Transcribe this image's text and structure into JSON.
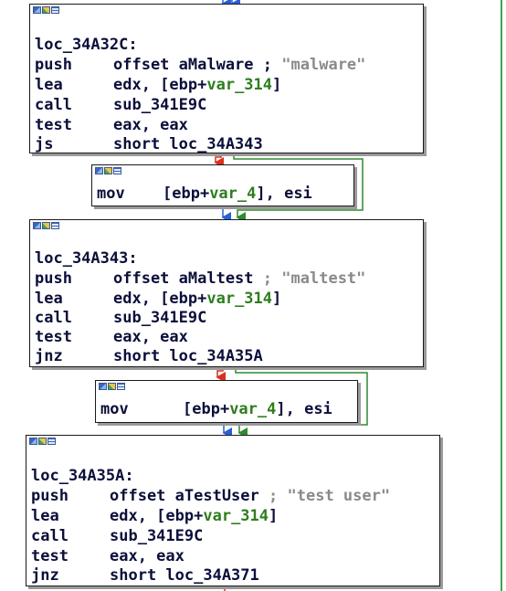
{
  "colors": {
    "true_edge": "#2e8b2e",
    "false_edge": "#d9301f",
    "flow_edge": "#2a5fd6",
    "variable": "#2e7d1e",
    "comment": "#8a8a8a",
    "rail": "#3aa655"
  },
  "header_icons": [
    "graph-view-icon",
    "edit-chart-icon",
    "hex-view-icon"
  ],
  "blocks": [
    {
      "label": "loc_34A32C:",
      "lines": [
        {
          "mnemonic": "push",
          "operand": "offset aMalware",
          "comment": "\"malware\""
        },
        {
          "mnemonic": "lea",
          "operand_pre": "edx, [ebp+",
          "operand_var": "var_314",
          "operand_post": "]"
        },
        {
          "mnemonic": "call",
          "operand": "sub_341E9C"
        },
        {
          "mnemonic": "test",
          "operand": "eax, eax"
        },
        {
          "mnemonic": "js",
          "operand": "short loc_34A343"
        }
      ]
    },
    {
      "lines": [
        {
          "mnemonic": "mov",
          "operand_pre": "[ebp+",
          "operand_var": "var_4",
          "operand_post": "], esi"
        }
      ]
    },
    {
      "label": "loc_34A343:",
      "lines": [
        {
          "mnemonic": "push",
          "operand": "offset aMaltest",
          "comment": "\"maltest\""
        },
        {
          "mnemonic": "lea",
          "operand_pre": "edx, [ebp+",
          "operand_var": "var_314",
          "operand_post": "]"
        },
        {
          "mnemonic": "call",
          "operand": "sub_341E9C"
        },
        {
          "mnemonic": "test",
          "operand": "eax, eax"
        },
        {
          "mnemonic": "jnz",
          "operand": "short loc_34A35A"
        }
      ]
    },
    {
      "lines": [
        {
          "mnemonic": "mov",
          "operand_pre": "[ebp+",
          "operand_var": "var_4",
          "operand_post": "], esi"
        }
      ]
    },
    {
      "label": "loc_34A35A:",
      "lines": [
        {
          "mnemonic": "push",
          "operand": "offset aTestUser",
          "comment": "\"test user\""
        },
        {
          "mnemonic": "lea",
          "operand_pre": "edx, [ebp+",
          "operand_var": "var_314",
          "operand_post": "]"
        },
        {
          "mnemonic": "call",
          "operand": "sub_341E9C"
        },
        {
          "mnemonic": "test",
          "operand": "eax, eax"
        },
        {
          "mnemonic": "jnz",
          "operand": "short loc_34A371"
        }
      ]
    }
  ],
  "comment_separator": ";"
}
